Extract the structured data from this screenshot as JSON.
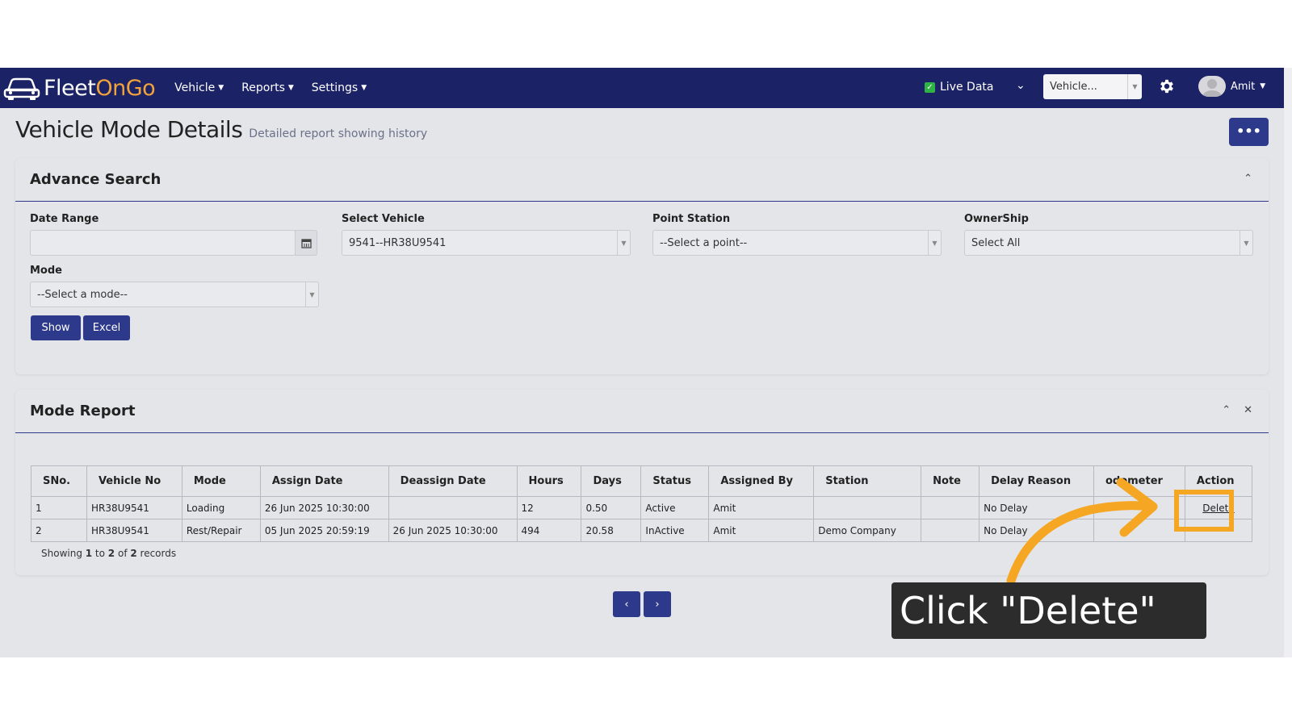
{
  "app": {
    "logo_fleet": "Fleet",
    "logo_on": "OnGo",
    "nav": [
      "Vehicle",
      "Reports",
      "Settings"
    ],
    "live_data_label": "Live Data",
    "vehicle_select_value": "Vehicle...",
    "user_name": "Amit"
  },
  "page": {
    "title": "Vehicle Mode Details",
    "subtitle": "Detailed report showing history",
    "more_label": "•••"
  },
  "advance_search": {
    "title": "Advance Search",
    "date_range_label": "Date Range",
    "date_range_value": "",
    "select_vehicle_label": "Select Vehicle",
    "select_vehicle_value": "9541--HR38U9541",
    "point_station_label": "Point Station",
    "point_station_value": "--Select a point--",
    "ownership_label": "OwnerShip",
    "ownership_value": "Select All",
    "mode_label": "Mode",
    "mode_value": "--Select a mode--",
    "show_button": "Show",
    "excel_button": "Excel"
  },
  "mode_report": {
    "title": "Mode Report",
    "columns": [
      "SNo.",
      "Vehicle No",
      "Mode",
      "Assign Date",
      "Deassign Date",
      "Hours",
      "Days",
      "Status",
      "Assigned By",
      "Station",
      "Note",
      "Delay Reason",
      "odometer",
      "Action"
    ],
    "rows": [
      [
        "1",
        "HR38U9541",
        "Loading",
        "26 Jun 2025 10:30:00",
        "",
        "12",
        "0.50",
        "Active",
        "Amit",
        "",
        "",
        "No Delay",
        "",
        "Delete"
      ],
      [
        "2",
        "HR38U9541",
        "Rest/Repair",
        "05 Jun 2025 20:59:19",
        "26 Jun 2025 10:30:00",
        "494",
        "20.58",
        "InActive",
        "Amit",
        "Demo Company",
        "",
        "No Delay",
        "",
        ""
      ]
    ],
    "showing_prefix": "Showing ",
    "showing_from": "1",
    "showing_to_word": " to ",
    "showing_to": "2",
    "showing_of_word": " of ",
    "showing_total": "2",
    "showing_suffix": " records"
  },
  "pagination": {
    "prev": "‹",
    "next": "›"
  },
  "tutorial": {
    "callout_text": "Click \"Delete\"",
    "accent_color": "#f5a623"
  },
  "colors": {
    "navbar": "#1c2266",
    "primary_button": "#2d3a8c",
    "logo_accent": "#f2a33a"
  }
}
